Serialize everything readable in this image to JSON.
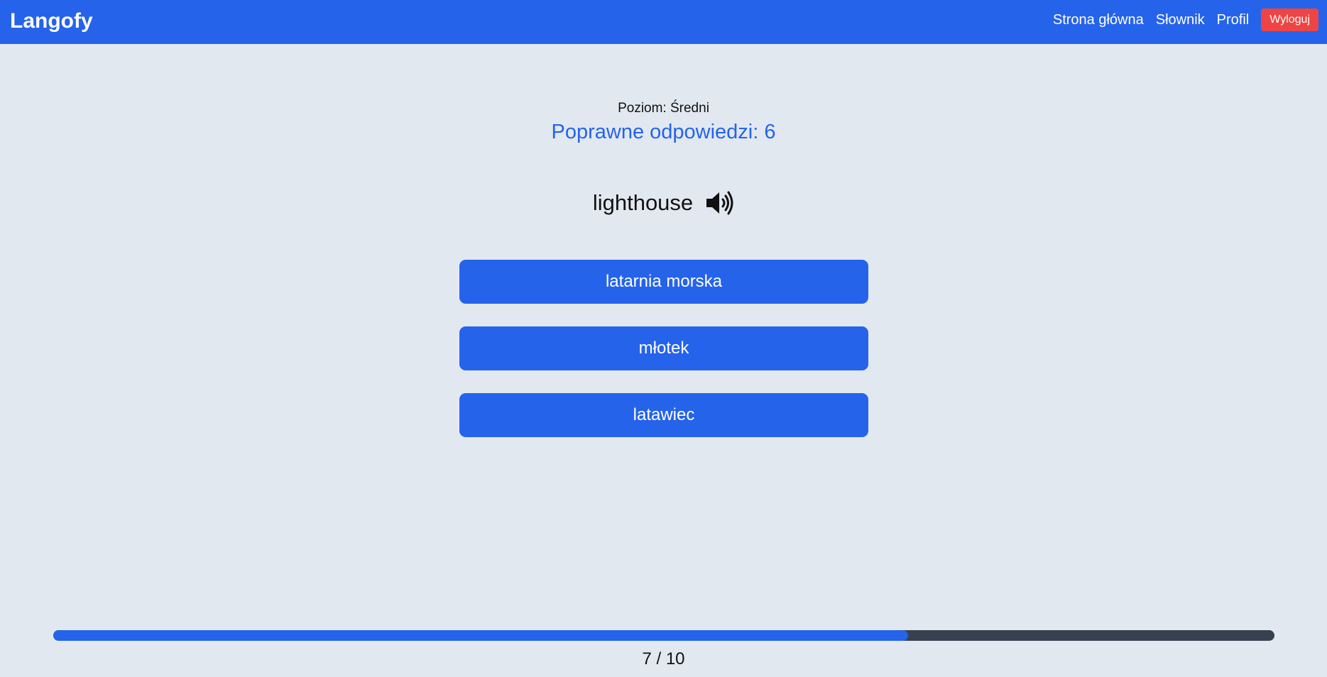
{
  "app": {
    "brand": "Langofy"
  },
  "nav": {
    "items": [
      {
        "label": "Strona główna"
      },
      {
        "label": "Słownik"
      },
      {
        "label": "Profil"
      }
    ],
    "logout_label": "Wyloguj"
  },
  "quiz": {
    "level_text": "Poziom: Średni",
    "score_text": "Poprawne odpowiedzi: 6",
    "word": "lighthouse",
    "speaker_icon": "speaker-icon",
    "answers": [
      {
        "label": "latarnia morska"
      },
      {
        "label": "młotek"
      },
      {
        "label": "latawiec"
      }
    ]
  },
  "progress": {
    "current": 7,
    "total": 10,
    "text": "7 / 10",
    "fraction": 0.7
  },
  "colors": {
    "primary": "#2563eb",
    "danger": "#ef4444",
    "background": "#e2e8f0",
    "track": "#374151"
  }
}
